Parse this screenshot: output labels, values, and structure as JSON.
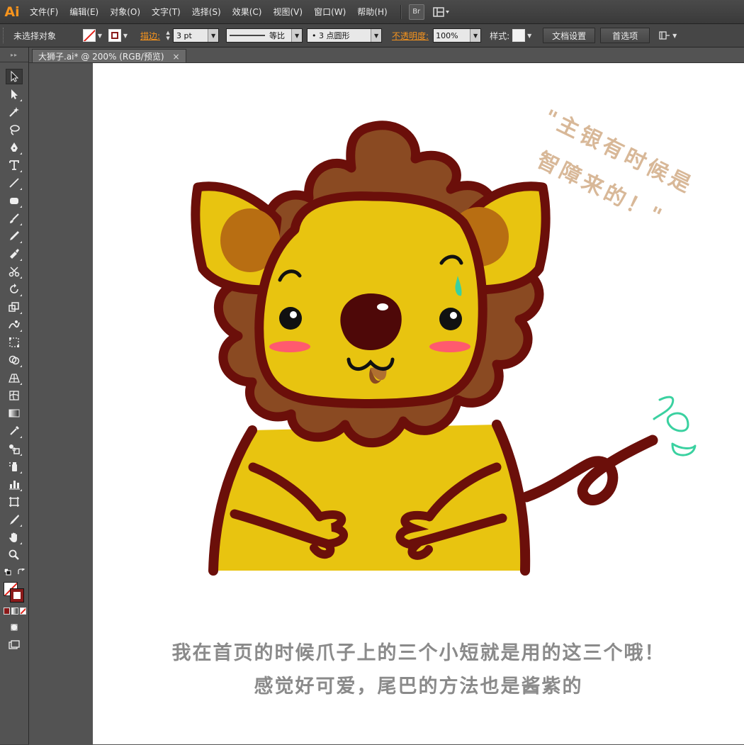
{
  "app": {
    "logo": "Ai"
  },
  "menu": {
    "items": [
      "文件(F)",
      "编辑(E)",
      "对象(O)",
      "文字(T)",
      "选择(S)",
      "效果(C)",
      "视图(V)",
      "窗口(W)",
      "帮助(H)"
    ],
    "bridge_label": "Br",
    "workspace_icon": "workspace-layout-icon"
  },
  "control": {
    "selection_status": "未选择对象",
    "stroke_label": "描边:",
    "stroke_weight": "3 pt",
    "stroke_profile": "等比",
    "brush_definition": "• 3 点圆形",
    "opacity_label": "不透明度:",
    "opacity_value": "100%",
    "style_label": "样式:",
    "doc_setup_label": "文档设置",
    "preferences_label": "首选项"
  },
  "document": {
    "tab_title": "大狮子.ai* @ 200% (RGB/预览)",
    "close_glyph": "×"
  },
  "artwork": {
    "caption_line1": "我在首页的时候爪子上的三个小短就是用的这三个哦！",
    "caption_line2": "感觉好可爱，尾巴的方法也是酱紫的",
    "quote_line1": "\"主银有时候是",
    "quote_line2": "智障来的！\""
  },
  "colors": {
    "accent_orange": "#f7941d",
    "lion_outline": "#6b0f0a",
    "lion_mane": "#8a4a22",
    "lion_body": "#e8c410",
    "lion_inner_ear": "#b86e12",
    "cheek": "#ff5a6e",
    "sweat": "#3ad1a0",
    "caption_gray": "#8a8a8a",
    "quote_tan": "#d8b898",
    "artboard": "#ffffff",
    "ui_dark": "#535353"
  }
}
